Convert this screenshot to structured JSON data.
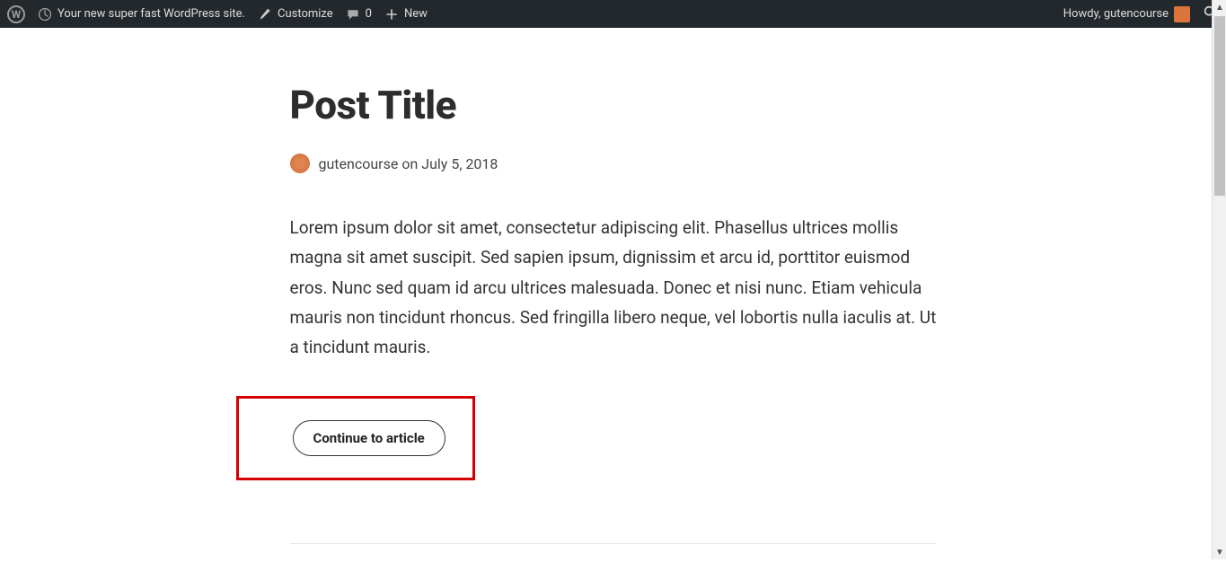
{
  "adminbar": {
    "site_name": "Your new super fast WordPress site.",
    "customize": "Customize",
    "comments_count": "0",
    "new": "New",
    "howdy_prefix": "Howdy, ",
    "user": "gutencourse"
  },
  "post": {
    "title": "Post Title",
    "author": "gutencourse",
    "meta_on": " on ",
    "date": "July 5, 2018",
    "excerpt": "Lorem ipsum dolor sit amet, consectetur adipiscing elit. Phasellus ultrices mollis magna sit amet suscipit. Sed sapien ipsum, dignissim et arcu id, porttitor euismod eros. Nunc sed quam id arcu ultrices malesuada. Donec et nisi nunc. Etiam vehicula mauris non tincidunt rhoncus. Sed fringilla libero neque, vel lobortis nulla iaculis at. Ut a tincidunt mauris.",
    "continue_label": "Continue to article"
  }
}
